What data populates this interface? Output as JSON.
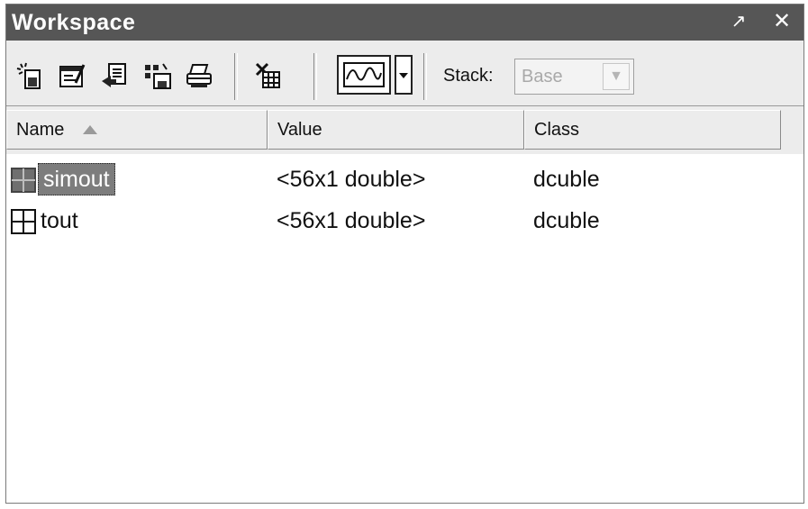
{
  "window": {
    "title": "Workspace",
    "undock_glyph": "↗",
    "close_glyph": "✕"
  },
  "toolbar": {
    "icons": [
      "new-variable-icon",
      "open-selection-icon",
      "import-data-icon",
      "save-icon",
      "print-icon",
      "delete-icon"
    ],
    "plot_icon": "waveform-plot-icon",
    "stack_label": "Stack:",
    "stack_value": "Base",
    "stack_arrow": "▼"
  },
  "columns": {
    "name": "Name",
    "value": "Value",
    "class": "Class"
  },
  "rows": [
    {
      "name": "simout",
      "value": "<56x1 double>",
      "class": "dcuble",
      "selected": true
    },
    {
      "name": "tout",
      "value": "<56x1 double>",
      "class": "dcuble",
      "selected": false
    }
  ],
  "colors": {
    "titlebar": "#565656",
    "toolbar_bg": "#ececec",
    "selection": "#7d7d7d"
  }
}
